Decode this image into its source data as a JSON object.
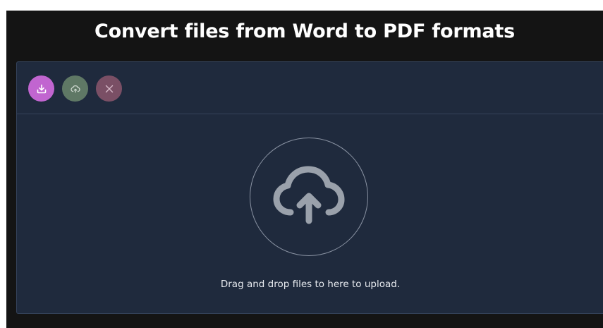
{
  "page": {
    "title": "Convert files from Word to PDF formats"
  },
  "toolbar": {
    "choose_icon": "download-icon",
    "upload_icon": "cloud-upload-icon",
    "cancel_icon": "close-icon"
  },
  "dropzone": {
    "icon": "cloud-upload-icon",
    "message": "Drag and drop files to here to upload."
  },
  "colors": {
    "background": "#141414",
    "panel": "#1f2a3d",
    "choose_button": "#c165d0",
    "upload_button": "#5f7865",
    "cancel_button": "#7a4f65"
  }
}
